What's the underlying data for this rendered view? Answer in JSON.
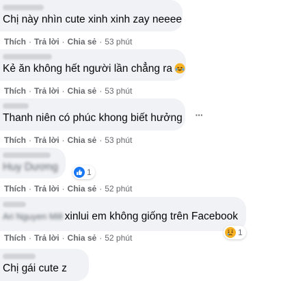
{
  "comments": [
    {
      "author": "Ngọc Như Phúc",
      "text": "Chị này nhìn cute xinh xinh zay neeee",
      "actions": {
        "like": "Thích",
        "reply": "Trả lời",
        "share": "Chia sẻ",
        "separator": "·",
        "time": "53 phút"
      }
    },
    {
      "author": "Nguyễn Anh Hữu",
      "text": "Kẻ ăn không hết người lần chẳng ra",
      "emoji": "crying-laughing-emoji",
      "actions": {
        "like": "Thích",
        "reply": "Trả lời",
        "share": "Chia sẻ",
        "separator": "·",
        "time": "53 phút"
      }
    },
    {
      "author": "Bill Tâm",
      "text": "Thanh niên có phúc khong biết hưởng",
      "more": "···",
      "actions": {
        "like": "Thích",
        "reply": "Trả lời",
        "share": "Chia sẻ",
        "separator": "·",
        "time": "53 phút"
      }
    },
    {
      "author": "Duyên Ngọc Trâm",
      "text": "Huy Dương",
      "reaction": {
        "type": "like",
        "count": "1"
      },
      "actions": {
        "like": "Thích",
        "reply": "Trả lời",
        "share": "Chia sẻ",
        "separator": "·",
        "time": "52 phút"
      }
    },
    {
      "author": "Quyễn",
      "mention": "Ari Nguyen Miltn",
      "text": "xinlui em không giống trên Facebook",
      "reaction": {
        "type": "sad",
        "count": "1"
      },
      "actions": {
        "like": "Thích",
        "reply": "Trả lời",
        "share": "Chia sẻ",
        "separator": "·",
        "time": "52 phút"
      }
    },
    {
      "author": "Minh Tuấn",
      "text": "Chị gái cute z"
    }
  ],
  "colors": {
    "bubble": "#f0f2f5",
    "text": "#050505",
    "meta": "#65676b",
    "like_blue": "#1877f2",
    "haha_yellow": "#f7b125"
  }
}
